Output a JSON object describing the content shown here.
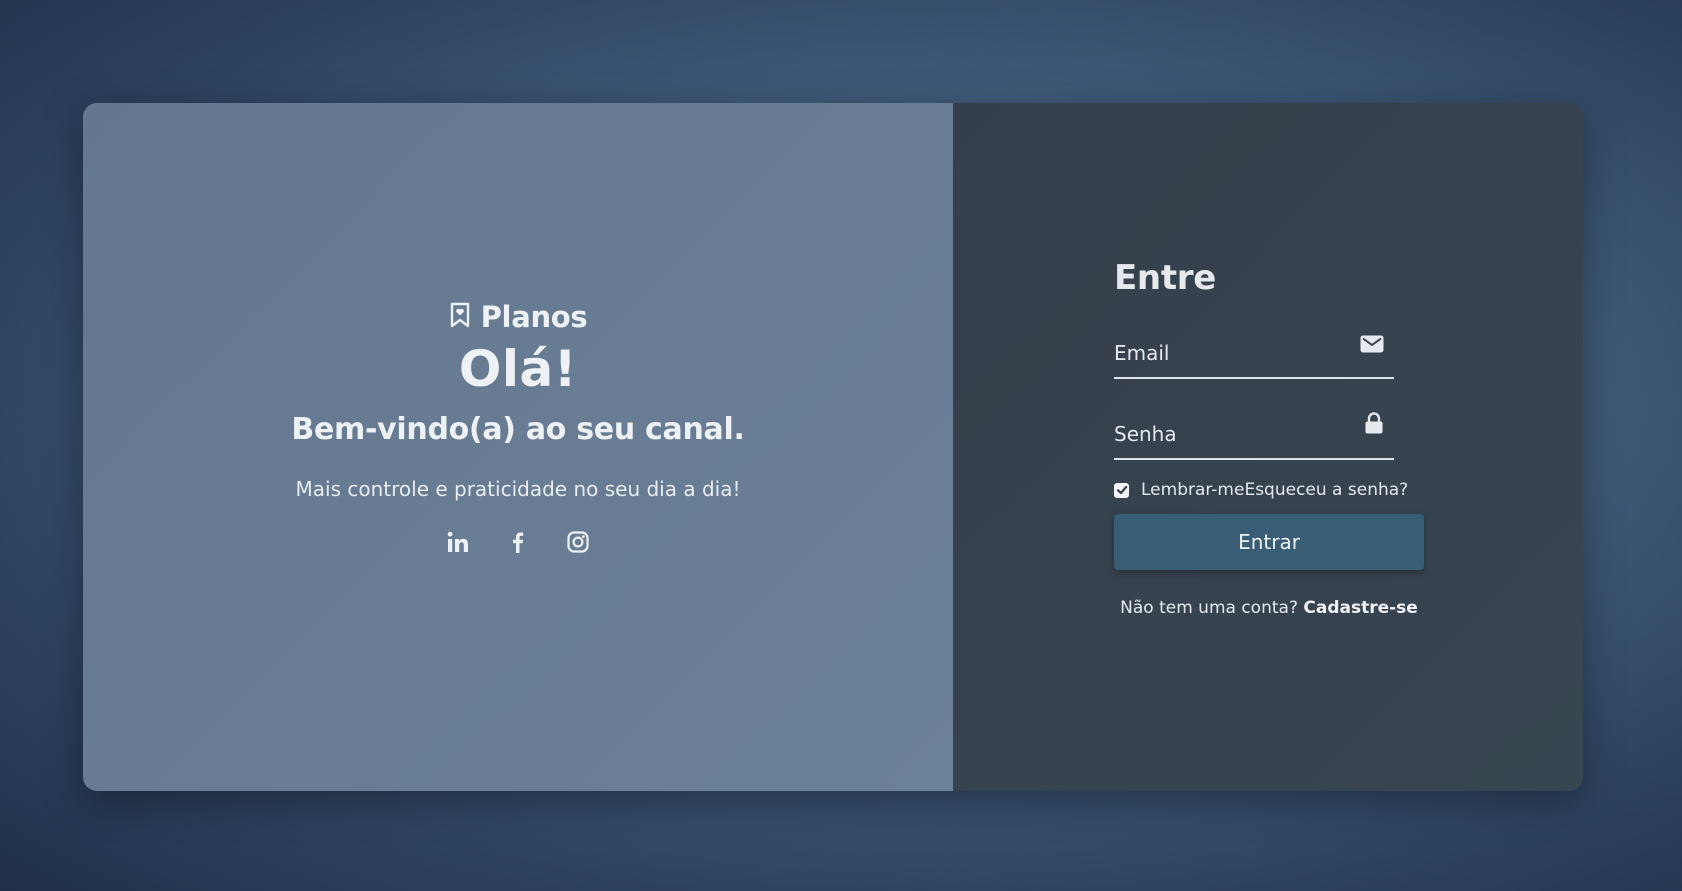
{
  "welcome_panel": {
    "brand_name": "Planos",
    "brand_icon": "bookmark-heart-icon",
    "greeting": "Olá!",
    "welcome_message": "Bem-vindo(a) ao seu canal.",
    "tagline": "Mais controle e praticidade no seu dia a dia!",
    "social_links": [
      {
        "name": "linkedin",
        "icon": "linkedin-icon"
      },
      {
        "name": "facebook",
        "icon": "facebook-icon"
      },
      {
        "name": "instagram",
        "icon": "instagram-icon"
      }
    ]
  },
  "login_form": {
    "title": "Entre",
    "email_placeholder": "Email",
    "email_icon": "envelope-icon",
    "password_placeholder": "Senha",
    "password_icon": "lock-icon",
    "remember_label": "Lembrar-me",
    "remember_checked": true,
    "forgot_label": "Esqueceu a senha?",
    "submit_label": "Entrar",
    "signup_prompt": "Não tem uma conta?",
    "signup_link": "Cadastre-se"
  },
  "colors": {
    "left_panel": "#677b93",
    "right_panel": "#363f4b",
    "button": "#385d74",
    "text": "#e6eaef"
  }
}
